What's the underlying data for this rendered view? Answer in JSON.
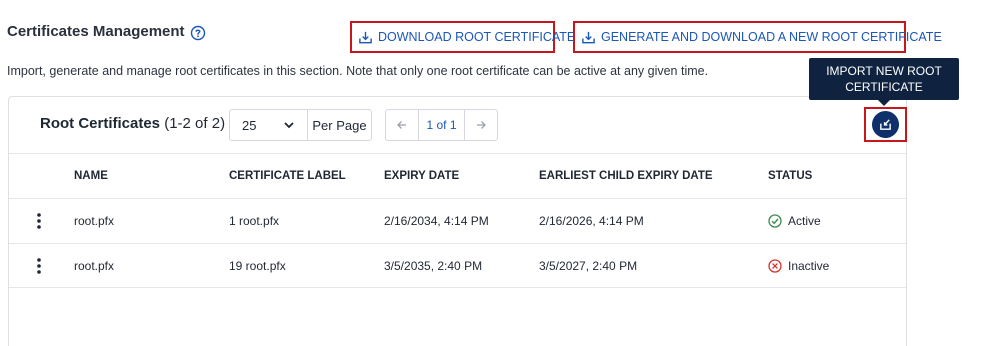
{
  "header": {
    "title": "Certificates Management",
    "download_label": "DOWNLOAD ROOT CERTIFICATE",
    "generate_label": "GENERATE AND DOWNLOAD A NEW ROOT CERTIFICATE",
    "description": "Import, generate and manage root certificates in this section. Note that only one root certificate can be active at any given time."
  },
  "tooltip": {
    "text": "IMPORT NEW ROOT CERTIFICATE"
  },
  "panel": {
    "title": "Root Certificates",
    "count": "(1-2 of 2)",
    "page_size_value": "25",
    "page_size_label": "Per Page",
    "pager_info": "1 of 1"
  },
  "table": {
    "columns": [
      "NAME",
      "CERTIFICATE LABEL",
      "EXPIRY DATE",
      "EARLIEST CHILD EXPIRY DATE",
      "STATUS"
    ],
    "rows": [
      {
        "name": "root.pfx",
        "label": "1 root.pfx",
        "expiry": "2/16/2034, 4:14 PM",
        "child_expiry": "2/16/2026, 4:14 PM",
        "status": "Active"
      },
      {
        "name": "root.pfx",
        "label": "19 root.pfx",
        "expiry": "3/5/2035, 2:40 PM",
        "child_expiry": "3/5/2027, 2:40 PM",
        "status": "Inactive"
      }
    ]
  },
  "icons": {
    "help": "help-circle-icon",
    "download": "download-icon",
    "import": "import-icon",
    "active": "check-circle-icon",
    "inactive": "x-circle-icon"
  },
  "colors": {
    "accent_blue": "#1b56b8",
    "highlight_red": "#c8161d",
    "navy": "#10306b",
    "active_green": "#3a8a4a",
    "inactive_red": "#d0342c"
  }
}
